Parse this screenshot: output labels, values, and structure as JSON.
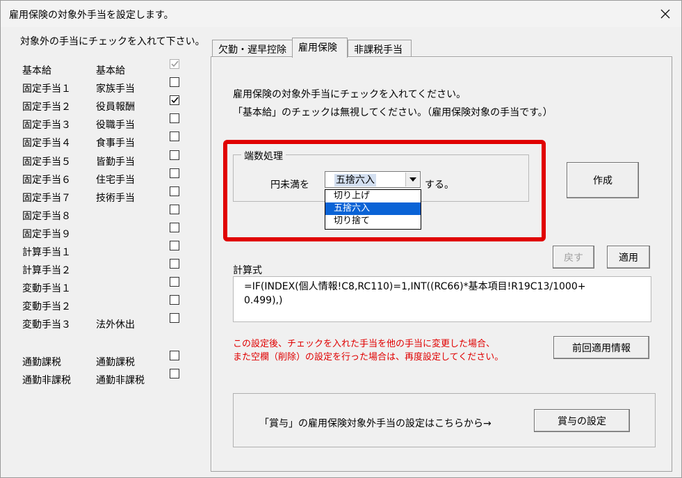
{
  "window": {
    "title": "雇用保険の対象外手当を設定します。"
  },
  "left": {
    "heading": "対象外の手当にチェックを入れて下さい。",
    "items": [
      {
        "code": "基本給",
        "name": "基本給",
        "checked": true,
        "disabled": true
      },
      {
        "code": "固定手当１",
        "name": "家族手当",
        "checked": false
      },
      {
        "code": "固定手当２",
        "name": "役員報酬",
        "checked": true
      },
      {
        "code": "固定手当３",
        "name": "役職手当",
        "checked": false
      },
      {
        "code": "固定手当４",
        "name": "食事手当",
        "checked": false
      },
      {
        "code": "固定手当５",
        "name": "皆勤手当",
        "checked": false
      },
      {
        "code": "固定手当６",
        "name": "住宅手当",
        "checked": false
      },
      {
        "code": "固定手当７",
        "name": "技術手当",
        "checked": false
      },
      {
        "code": "固定手当８",
        "name": "",
        "checked": false
      },
      {
        "code": "固定手当９",
        "name": "",
        "checked": false
      },
      {
        "code": "計算手当１",
        "name": "",
        "checked": false
      },
      {
        "code": "計算手当２",
        "name": "",
        "checked": false
      },
      {
        "code": "変動手当１",
        "name": "",
        "checked": false
      },
      {
        "code": "変動手当２",
        "name": "",
        "checked": false
      },
      {
        "code": "変動手当３",
        "name": "法外休出",
        "checked": false
      }
    ],
    "commute_items": [
      {
        "code": "通勤課税",
        "name": "通勤課税",
        "checked": false
      },
      {
        "code": "通勤非課税",
        "name": "通勤非課税",
        "checked": false
      }
    ]
  },
  "tabs": [
    {
      "label": "欠勤・遅早控除"
    },
    {
      "label": "雇用保険"
    },
    {
      "label": "非課税手当"
    }
  ],
  "main": {
    "instruction_1": "雇用保険の対象外手当にチェックを入れてください。",
    "instruction_2": "「基本給」のチェックは無視してください。（雇用保険対象の手当です。）",
    "rounding": {
      "group_label": "端数処理",
      "prefix": "円未満を",
      "selected": "五捨六入",
      "suffix": "する。",
      "options": [
        "切り上げ",
        "五捨六入",
        "切り捨て"
      ]
    },
    "create_button": "作成",
    "back_button": "戻す",
    "apply_button": "適用",
    "formula_label": "計算式",
    "formula_value": "=IF(INDEX(個人情報!C8,RC110)=1,INT((RC66)*基本項目!R19C13/1000+\n0.499),)",
    "warning_line_1": "この設定後、チェックを入れた手当を他の手当に変更した場合、",
    "warning_line_2": "また空欄（削除）の設定を行った場合は、再度設定してください。",
    "prev_info_button": "前回適用情報",
    "bonus_text": "「賞与」の雇用保険対象外手当の設定はこちらから→",
    "bonus_button": "賞与の設定"
  },
  "colors": {
    "highlight": "#e00000",
    "selection": "#0a63d6",
    "warning_text": "#e00000"
  }
}
